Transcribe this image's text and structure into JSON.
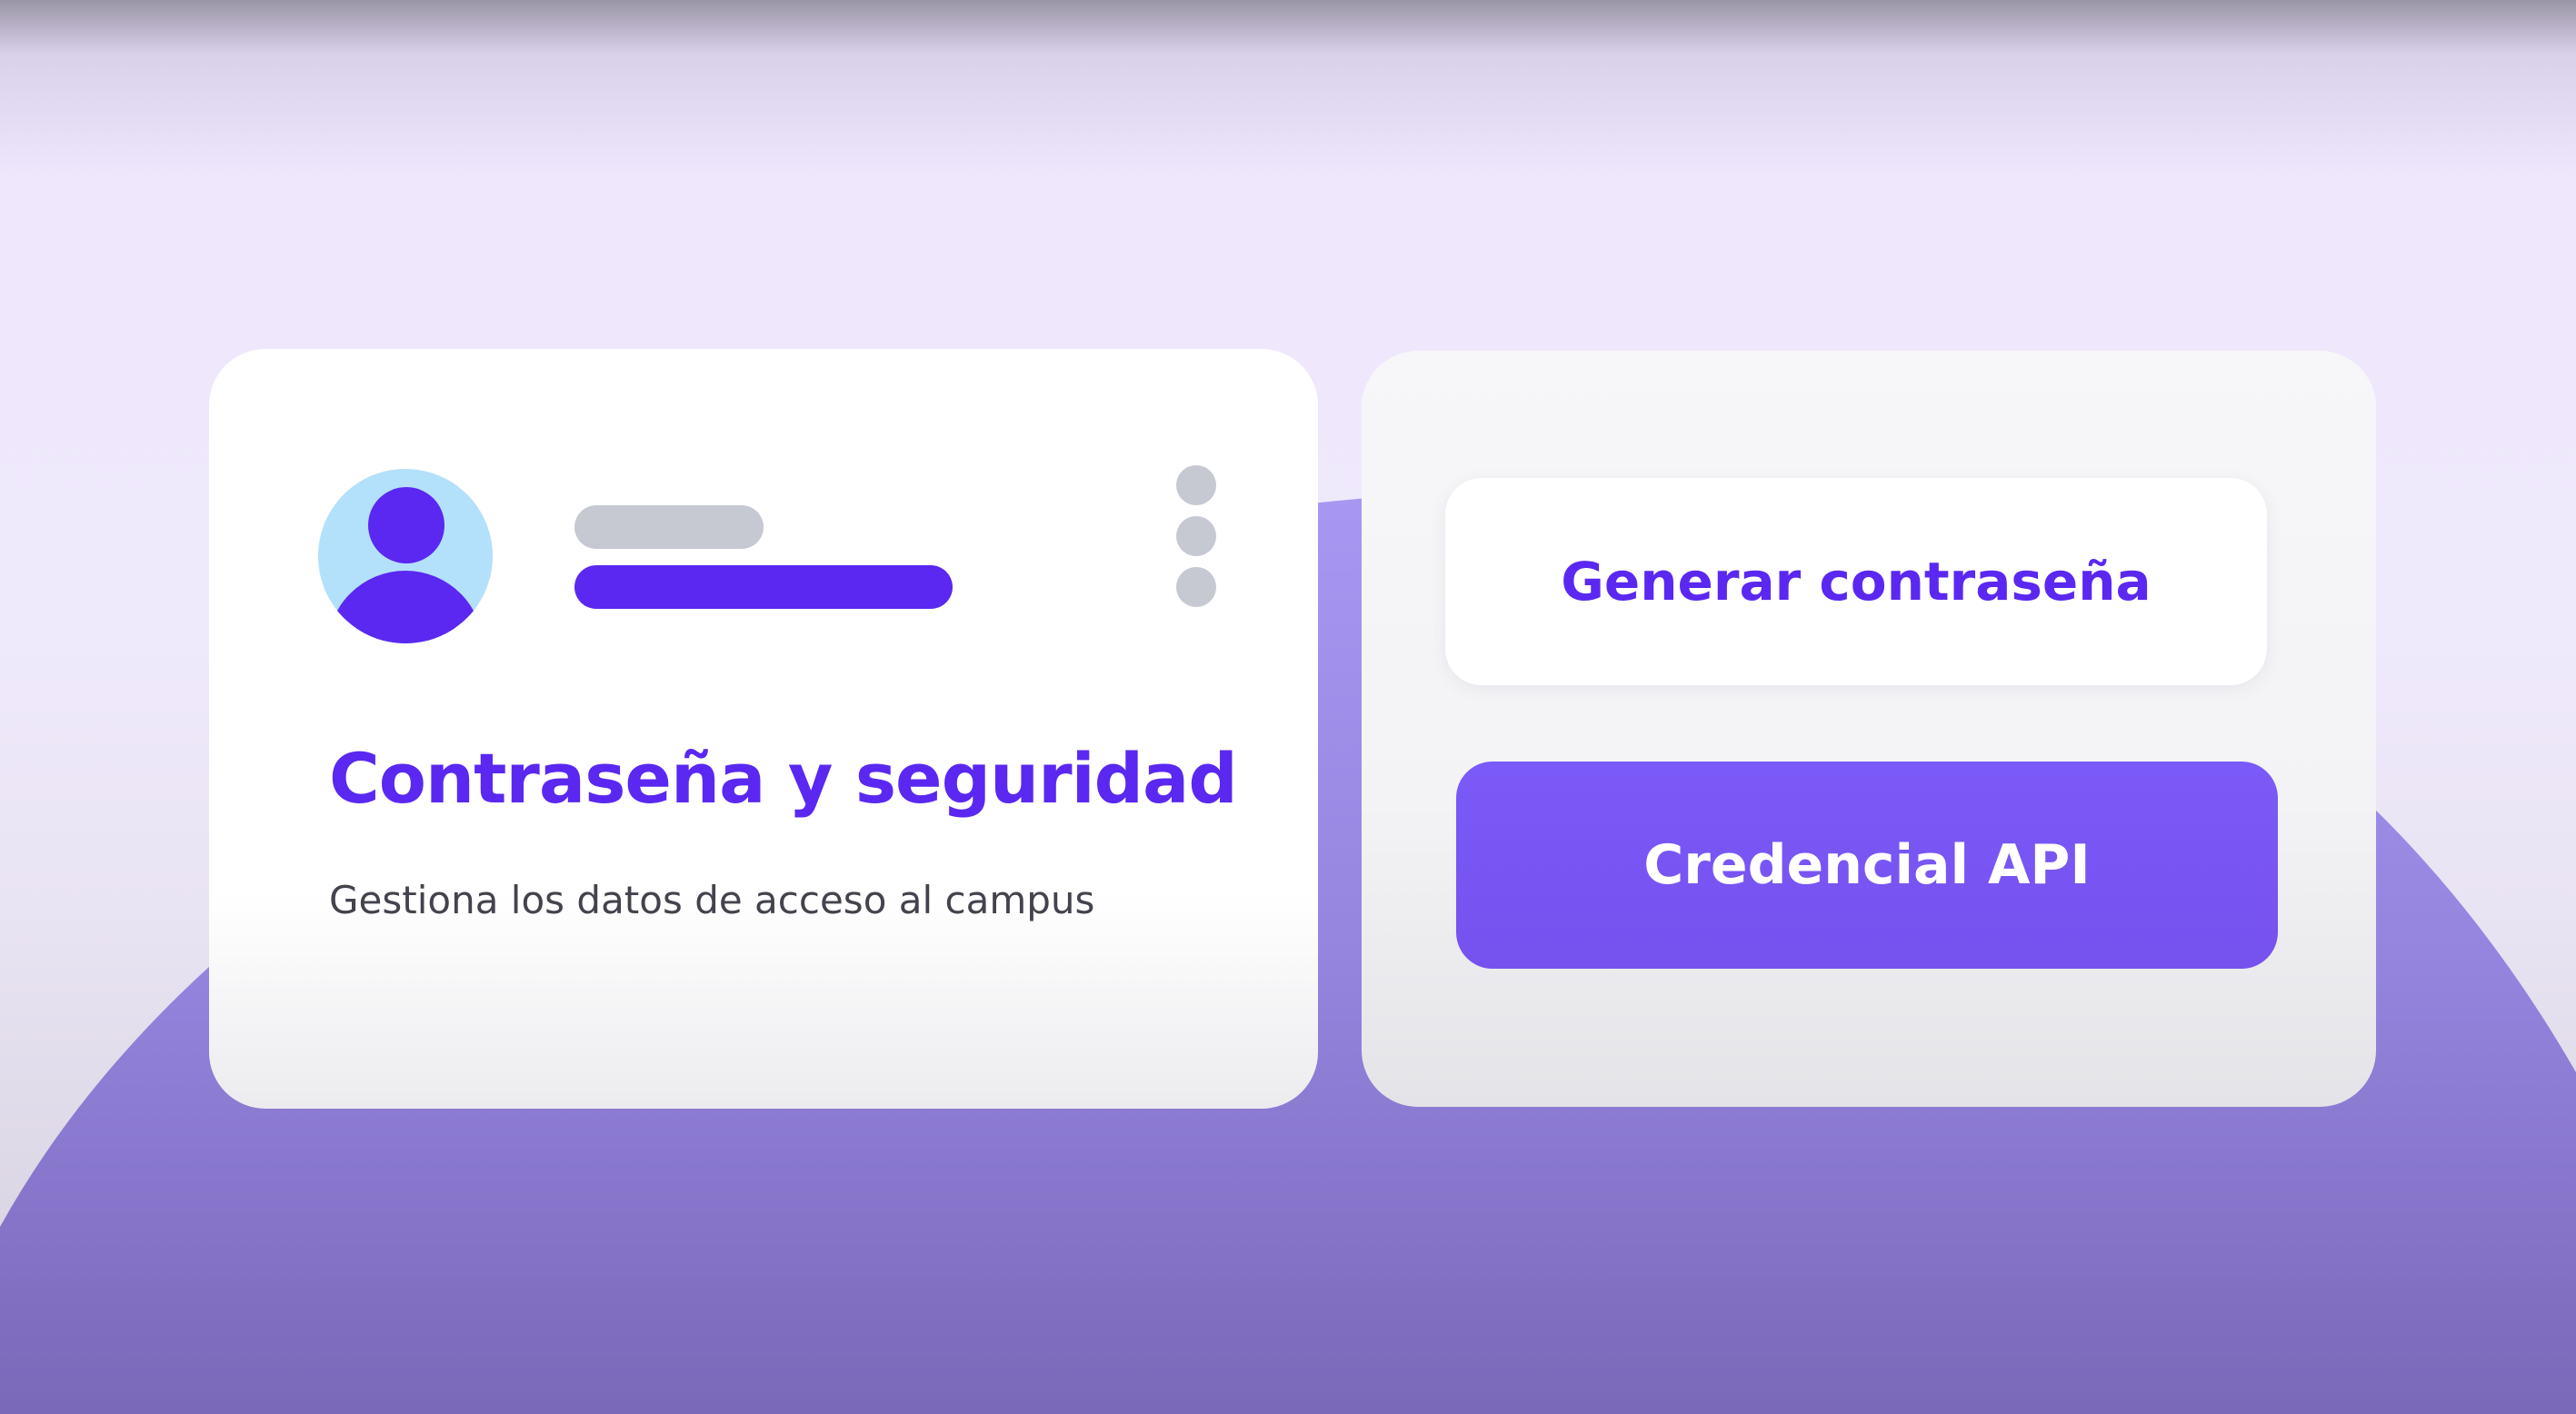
{
  "colors": {
    "brand": "#5a28f0",
    "accent_button": "#7a5af8",
    "avatar_bg": "#b3e0fb",
    "placeholder_grey": "#c6c8d2"
  },
  "profile_card": {
    "avatar_icon": "user-avatar-icon",
    "menu_icon": "more-vertical-icon",
    "title": "Contraseña y seguridad",
    "subtitle": "Gestiona los datos de acceso al campus"
  },
  "actions": {
    "generate_password_label": "Generar contraseña",
    "api_credential_label": "Credencial API"
  }
}
